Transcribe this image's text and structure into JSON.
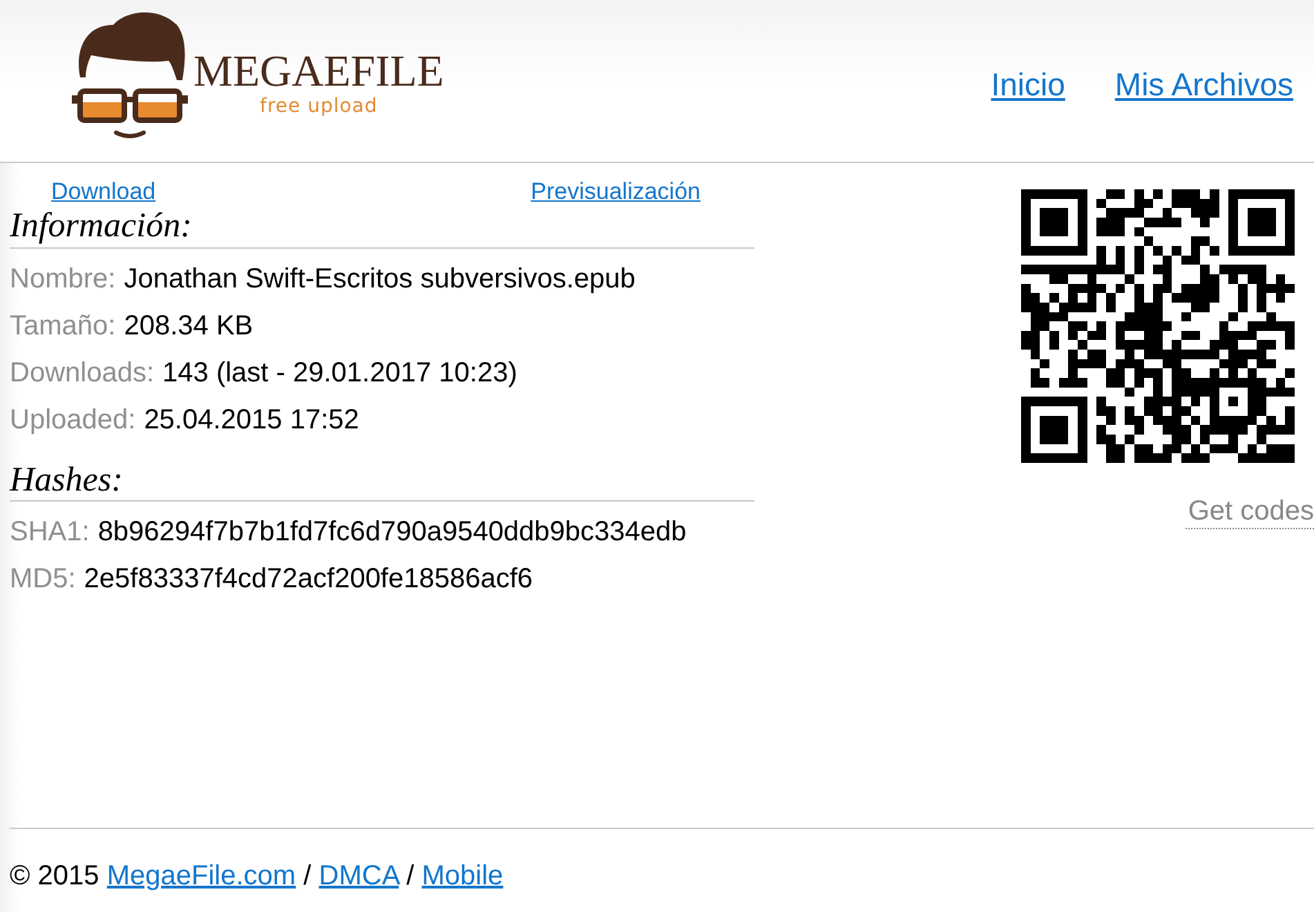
{
  "header": {
    "logo": {
      "name": "MEGAEFILE",
      "tagline": "free upload"
    },
    "nav": [
      {
        "label": "Inicio"
      },
      {
        "label": "Mis Archivos"
      }
    ]
  },
  "file_links": [
    {
      "label": "Download"
    },
    {
      "label": "Previsualización"
    }
  ],
  "info": {
    "title": "Información:",
    "fields": [
      {
        "label": "Nombre:",
        "value": "Jonathan Swift-Escritos subversivos.epub"
      },
      {
        "label": "Tamaño:",
        "value": "208.34 KB"
      },
      {
        "label": "Downloads:",
        "value": "143 (last - 29.01.2017 10:23)"
      },
      {
        "label": "Uploaded:",
        "value": "25.04.2015 17:52"
      }
    ]
  },
  "hashes": {
    "title": "Hashes:",
    "fields": [
      {
        "label": "SHA1:",
        "value": "8b96294f7b7b1fd7fc6d790a9540ddb9bc334edb"
      },
      {
        "label": "MD5:",
        "value": "2e5f83337f4cd72acf200fe18586acf6"
      }
    ]
  },
  "qr": {
    "link": "Get codes"
  },
  "footer": {
    "items": [
      {
        "kind": "text",
        "text": "© 2015"
      },
      {
        "kind": "link",
        "text": "MegaeFile.com"
      },
      {
        "kind": "text",
        "text": "/"
      },
      {
        "kind": "link",
        "text": "DMCA"
      },
      {
        "kind": "text",
        "text": "/"
      },
      {
        "kind": "link",
        "text": "Mobile"
      }
    ]
  }
}
